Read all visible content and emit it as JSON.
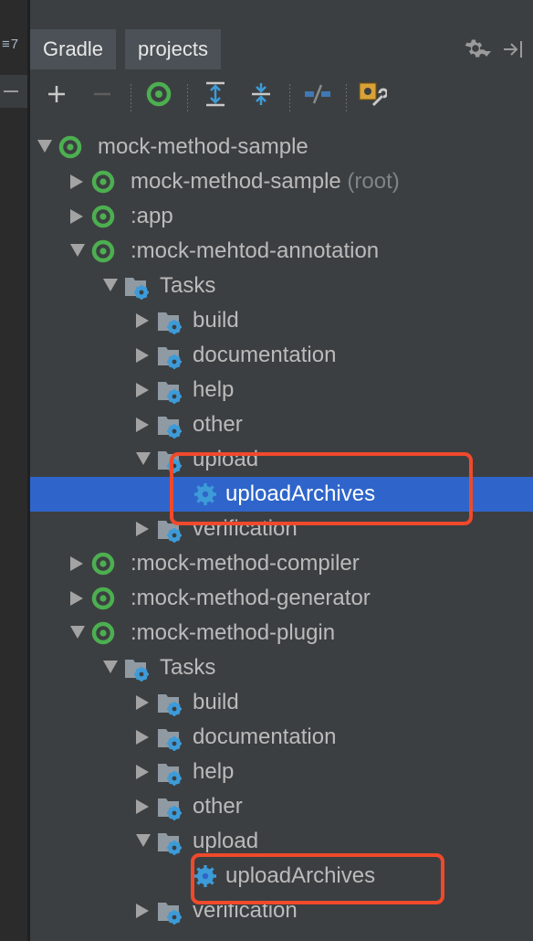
{
  "left_panel": {
    "badge": "≡7"
  },
  "header": {
    "tabs": [
      "Gradle",
      "projects"
    ],
    "gear_icon": "gear-icon",
    "hide_icon": "hide-panel-icon"
  },
  "toolbar": {
    "buttons": [
      {
        "name": "add-button",
        "icon": "plus-icon"
      },
      {
        "name": "remove-button",
        "icon": "minus-icon"
      },
      {
        "name": "refresh-button",
        "icon": "gradle-refresh-icon"
      },
      {
        "name": "expand-all-button",
        "icon": "expand-all-icon"
      },
      {
        "name": "collapse-all-button",
        "icon": "collapse-all-icon"
      },
      {
        "name": "offline-mode-button",
        "icon": "offline-icon"
      },
      {
        "name": "settings-button",
        "icon": "build-settings-icon"
      }
    ]
  },
  "tree": [
    {
      "label": "mock-method-sample",
      "suffix": "",
      "depth": 0,
      "icon": "gradle-project",
      "expanded": true
    },
    {
      "label": "mock-method-sample",
      "suffix": " (root)",
      "depth": 1,
      "icon": "gradle-project",
      "expanded": false
    },
    {
      "label": ":app",
      "suffix": "",
      "depth": 1,
      "icon": "gradle-project",
      "expanded": false
    },
    {
      "label": ":mock-mehtod-annotation",
      "suffix": "",
      "depth": 1,
      "icon": "gradle-project",
      "expanded": true
    },
    {
      "label": "Tasks",
      "suffix": "",
      "depth": 2,
      "icon": "task-folder",
      "expanded": true
    },
    {
      "label": "build",
      "suffix": "",
      "depth": 3,
      "icon": "task-folder",
      "expanded": false
    },
    {
      "label": "documentation",
      "suffix": "",
      "depth": 3,
      "icon": "task-folder",
      "expanded": false
    },
    {
      "label": "help",
      "suffix": "",
      "depth": 3,
      "icon": "task-folder",
      "expanded": false
    },
    {
      "label": "other",
      "suffix": "",
      "depth": 3,
      "icon": "task-folder",
      "expanded": false
    },
    {
      "label": "upload",
      "suffix": "",
      "depth": 3,
      "icon": "task-folder",
      "expanded": true
    },
    {
      "label": "uploadArchives",
      "suffix": "",
      "depth": 4,
      "icon": "task-gear",
      "expanded": null,
      "selected": true
    },
    {
      "label": "verification",
      "suffix": "",
      "depth": 3,
      "icon": "task-folder",
      "expanded": false
    },
    {
      "label": ":mock-method-compiler",
      "suffix": "",
      "depth": 1,
      "icon": "gradle-project",
      "expanded": false
    },
    {
      "label": ":mock-method-generator",
      "suffix": "",
      "depth": 1,
      "icon": "gradle-project",
      "expanded": false
    },
    {
      "label": ":mock-method-plugin",
      "suffix": "",
      "depth": 1,
      "icon": "gradle-project",
      "expanded": true
    },
    {
      "label": "Tasks",
      "suffix": "",
      "depth": 2,
      "icon": "task-folder",
      "expanded": true
    },
    {
      "label": "build",
      "suffix": "",
      "depth": 3,
      "icon": "task-folder",
      "expanded": false
    },
    {
      "label": "documentation",
      "suffix": "",
      "depth": 3,
      "icon": "task-folder",
      "expanded": false
    },
    {
      "label": "help",
      "suffix": "",
      "depth": 3,
      "icon": "task-folder",
      "expanded": false
    },
    {
      "label": "other",
      "suffix": "",
      "depth": 3,
      "icon": "task-folder",
      "expanded": false
    },
    {
      "label": "upload",
      "suffix": "",
      "depth": 3,
      "icon": "task-folder",
      "expanded": true
    },
    {
      "label": "uploadArchives",
      "suffix": "",
      "depth": 4,
      "icon": "task-gear",
      "expanded": null
    },
    {
      "label": "verification",
      "suffix": "",
      "depth": 3,
      "icon": "task-folder",
      "expanded": false
    }
  ],
  "colors": {
    "background": "#3c3f41",
    "selection": "#2f65ca",
    "gradle_green": "#4caf50",
    "task_blue": "#3d9bd8",
    "annotation_red": "#f0492b"
  }
}
